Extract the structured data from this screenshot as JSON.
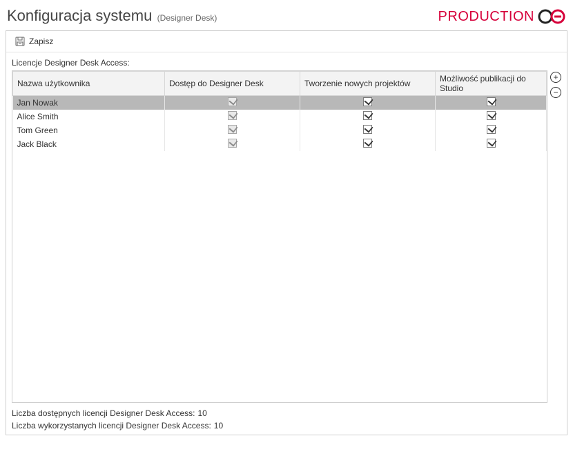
{
  "header": {
    "title": "Konfiguracja systemu",
    "subtitle": "(Designer Desk)",
    "brand": "PRODUCTION"
  },
  "toolbar": {
    "save_label": "Zapisz"
  },
  "section": {
    "label": "Licencje Designer Desk Access:"
  },
  "columns": {
    "c0": "Nazwa użytkownika",
    "c1": "Dostęp do Designer Desk",
    "c2": "Tworzenie nowych projektów",
    "c3": "Możliwość publikacji do Studio"
  },
  "rows": [
    {
      "user": "Jan Nowak",
      "access": true,
      "create": true,
      "publish": true,
      "selected": true
    },
    {
      "user": "Alice Smith",
      "access": true,
      "create": true,
      "publish": true,
      "selected": false
    },
    {
      "user": "Tom Green",
      "access": true,
      "create": true,
      "publish": true,
      "selected": false
    },
    {
      "user": "Jack Black",
      "access": true,
      "create": true,
      "publish": true,
      "selected": false
    }
  ],
  "footer": {
    "available_label": "Liczba dostępnych licencji Designer Desk Access:",
    "available_value": "10",
    "used_label": "Liczba wykorzystanych licencji Designer Desk Access:",
    "used_value": "10"
  }
}
